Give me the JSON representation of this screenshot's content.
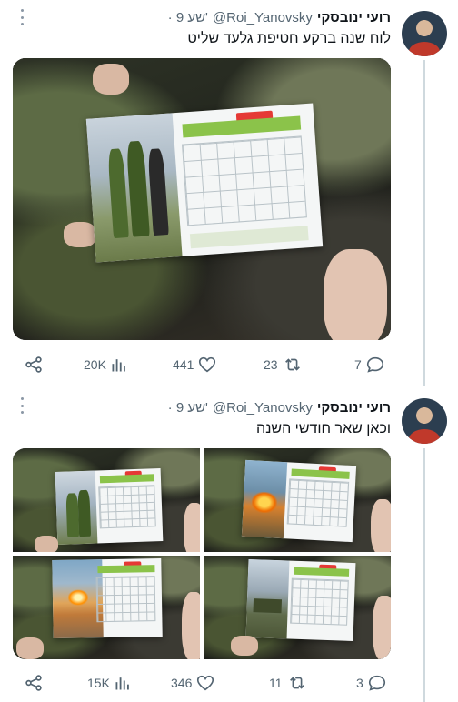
{
  "tweets": [
    {
      "display_name": "רועי ינובסקי",
      "handle": "@Roi_Yanovsky",
      "time": "· 9 שע'",
      "text": "לוח שנה ברקע חטיפת גלעד שליט",
      "stats": {
        "views": "20K",
        "likes": "441",
        "retweets": "23",
        "replies": "7"
      }
    },
    {
      "display_name": "רועי ינובסקי",
      "handle": "@Roi_Yanovsky",
      "time": "· 9 שע'",
      "text": "וכאן שאר חודשי השנה",
      "stats": {
        "views": "15K",
        "likes": "346",
        "retweets": "11",
        "replies": "3"
      }
    }
  ],
  "colors": {
    "accent_line": "#cfd9de",
    "icon_gray": "#536471",
    "calendar_green": "#8bc34a",
    "calendar_red": "#e53935"
  },
  "icons": [
    "share-icon",
    "views-icon",
    "like-icon",
    "retweet-icon",
    "reply-icon",
    "more-icon"
  ]
}
